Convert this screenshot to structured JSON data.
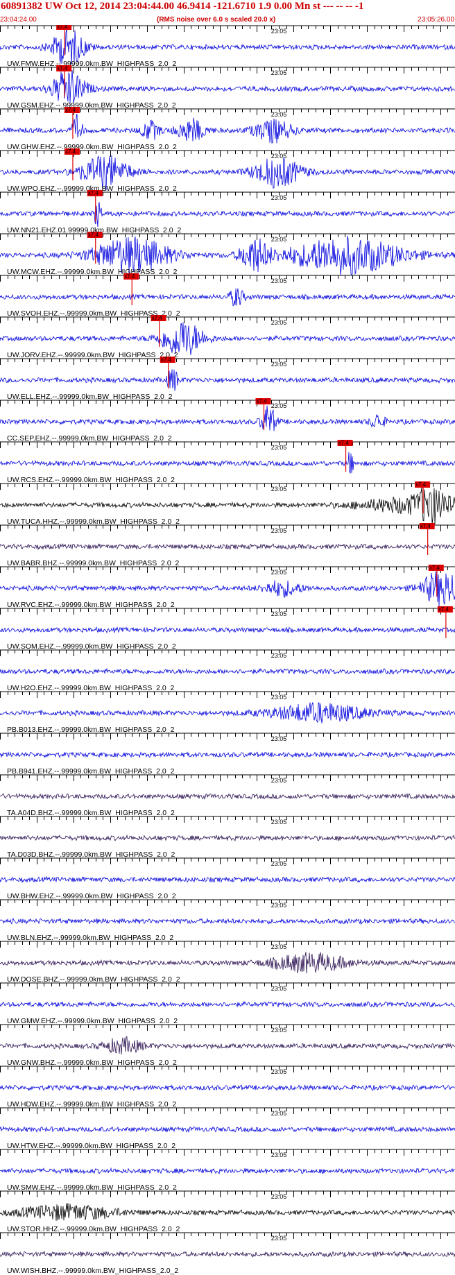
{
  "header": {
    "title": "60891382 UW Oct 12, 2014 23:04:44.00   46.9414 -121.6710  1.9 0.00 Mn st --- -- --   -1",
    "start_time": "23:04:24.00",
    "note": "(RMS noise over 6.0 s scaled 20.0 x)",
    "end_time": "23:05:26.00"
  },
  "minute_label": "23:05",
  "pick_label": "x7.4",
  "colors": {
    "header_text": "#cc0000",
    "trace_blue": "#0000dd",
    "trace_black": "#000000",
    "trace_purple": "#2a1050",
    "pick_marker": "#dd0000",
    "axis": "#000000"
  },
  "traces": [
    {
      "label": "UW.FMW.EHZ.--.99999.0km.BW_HIGHPASS_2.0_2",
      "color": "blue",
      "pick": 0.142,
      "bursts": [
        {
          "c": 0.15,
          "w": 0.035,
          "a": 1.0
        }
      ]
    },
    {
      "label": "UW.GSM.EHZ.--.99999.0km.BW_HIGHPASS_2.0_2",
      "color": "blue",
      "pick": 0.142,
      "bursts": [
        {
          "c": 0.15,
          "w": 0.035,
          "a": 1.0
        }
      ]
    },
    {
      "label": "UW.GHW.EHZ.--.99999.0km.BW_HIGHPASS_2.0_2",
      "color": "blue",
      "pick": 0.16,
      "bursts": [
        {
          "c": 0.17,
          "w": 0.01,
          "a": 0.8
        },
        {
          "c": 0.33,
          "w": 0.02,
          "a": 0.5
        },
        {
          "c": 0.42,
          "w": 0.03,
          "a": 0.6
        },
        {
          "c": 0.6,
          "w": 0.04,
          "a": 0.6
        }
      ]
    },
    {
      "label": "UW.WPO.EHZ.--.99999.0km.BW_HIGHPASS_2.0_2",
      "color": "blue",
      "pick": 0.16,
      "bursts": [
        {
          "c": 0.23,
          "w": 0.05,
          "a": 0.9
        },
        {
          "c": 0.61,
          "w": 0.05,
          "a": 0.8
        }
      ]
    },
    {
      "label": "UW.NN21.EHZ.01.99999.0km.BW_HIGHPASS_2.0_2",
      "color": "blue",
      "pick": 0.21,
      "bursts": [
        {
          "c": 0.215,
          "w": 0.008,
          "a": 0.7
        }
      ]
    },
    {
      "label": "UW.MCW.EHZ.--.99999.0km.BW_HIGHPASS_2.0_2",
      "color": "blue",
      "pick": 0.21,
      "bursts": [
        {
          "c": 0.29,
          "w": 0.08,
          "a": 1.0
        },
        {
          "c": 0.56,
          "w": 0.03,
          "a": 0.9
        },
        {
          "c": 0.76,
          "w": 0.12,
          "a": 1.0
        }
      ]
    },
    {
      "label": "UW.SVOH.EHZ.--.99999.0km.BW_HIGHPASS_2.0_2",
      "color": "blue",
      "pick": 0.29,
      "bursts": [
        {
          "c": 0.52,
          "w": 0.015,
          "a": 0.5
        }
      ]
    },
    {
      "label": "UW.JORV.EHZ.--.99999.0km.BW_HIGHPASS_2.0_2",
      "color": "blue",
      "pick": 0.35,
      "bursts": [
        {
          "c": 0.4,
          "w": 0.045,
          "a": 1.0
        }
      ]
    },
    {
      "label": "UW.ELL.EHZ.--.99999.0km.BW_HIGHPASS_2.0_2",
      "color": "blue",
      "pick": 0.37,
      "bursts": [
        {
          "c": 0.38,
          "w": 0.012,
          "a": 0.6
        }
      ]
    },
    {
      "label": "CC.SEP.EHZ.--.99999.0km.BW_HIGHPASS_2.0_2",
      "color": "blue",
      "pick": 0.58,
      "bursts": [
        {
          "c": 0.59,
          "w": 0.015,
          "a": 0.9
        },
        {
          "c": 0.83,
          "w": 0.015,
          "a": 0.4
        }
      ]
    },
    {
      "label": "UW.RCS.EHZ.--.99999.0km.BW_HIGHPASS_2.0_2",
      "color": "blue",
      "pick": 0.76,
      "bursts": [
        {
          "c": 0.77,
          "w": 0.006,
          "a": 0.7
        }
      ]
    },
    {
      "label": "UW.TUCA.HHZ.--.99999.0km.BW_HIGHPASS_2.0_2",
      "color": "black",
      "pick": 0.93,
      "bursts": [
        {
          "c": 0.92,
          "w": 0.12,
          "a": 0.45
        },
        {
          "c": 0.95,
          "w": 0.025,
          "a": 1.0
        }
      ]
    },
    {
      "label": "UW.BABR.BHZ.--.99999.0km.BW_HIGHPASS_2.0_2",
      "color": "purple",
      "pick": 0.94,
      "bursts": []
    },
    {
      "label": "UW.RVC.EHZ.--.99999.0km.BW_HIGHPASS_2.0_2",
      "color": "blue",
      "pick": 0.96,
      "bursts": [
        {
          "c": 0.62,
          "w": 0.04,
          "a": 0.4
        },
        {
          "c": 0.97,
          "w": 0.04,
          "a": 1.0
        }
      ]
    },
    {
      "label": "UW.SOM.EHZ.--.99999.0km.BW_HIGHPASS_2.0_2",
      "color": "blue",
      "pick": 0.98,
      "bursts": []
    },
    {
      "label": "UW.H2O.EHZ.--.99999.0km.BW_HIGHPASS_2.0_2",
      "color": "blue",
      "pick": null,
      "bursts": []
    },
    {
      "label": "PB.B013.EHZ.--.99999.0km.BW_HIGHPASS_2.0_2",
      "color": "blue",
      "pick": null,
      "bursts": [
        {
          "c": 0.7,
          "w": 0.1,
          "a": 0.5
        }
      ]
    },
    {
      "label": "PB.B941.EHZ.--.99999.0km.BW_HIGHPASS_2.0_2",
      "color": "blue",
      "pick": null,
      "bursts": []
    },
    {
      "label": "TA.A04D.BHZ.--.99999.0km.BW_HIGHPASS_2.0_2",
      "color": "purple",
      "pick": null,
      "bursts": []
    },
    {
      "label": "TA.D03D.BHZ.--.99999.0km.BW_HIGHPASS_2.0_2",
      "color": "purple",
      "pick": null,
      "bursts": []
    },
    {
      "label": "UW.BHW.EHZ.--.99999.0km.BW_HIGHPASS_2.0_2",
      "color": "blue",
      "pick": null,
      "bursts": []
    },
    {
      "label": "UW.BLN.EHZ.--.99999.0km.BW_HIGHPASS_2.0_2",
      "color": "blue",
      "pick": null,
      "bursts": []
    },
    {
      "label": "UW.DOSE.BHZ.--.99999.0km.BW_HIGHPASS_2.0_2",
      "color": "purple",
      "pick": null,
      "bursts": [
        {
          "c": 0.68,
          "w": 0.08,
          "a": 0.5
        }
      ]
    },
    {
      "label": "UW.GMW.EHZ.--.99999.0km.BW_HIGHPASS_2.0_2",
      "color": "blue",
      "pick": null,
      "bursts": []
    },
    {
      "label": "UW.GNW.BHZ.--.99999.0km.BW_HIGHPASS_2.0_2",
      "color": "purple",
      "pick": null,
      "bursts": [
        {
          "c": 0.27,
          "w": 0.04,
          "a": 0.4
        }
      ]
    },
    {
      "label": "UW.HDW.EHZ.--.99999.0km.BW_HIGHPASS_2.0_2",
      "color": "blue",
      "pick": null,
      "bursts": []
    },
    {
      "label": "UW.HTW.EHZ.--.99999.0km.BW_HIGHPASS_2.0_2",
      "color": "blue",
      "pick": null,
      "bursts": []
    },
    {
      "label": "UW.SMW.EHZ.--.99999.0km.BW_HIGHPASS_2.0_2",
      "color": "blue",
      "pick": null,
      "bursts": []
    },
    {
      "label": "UW.STOR.HHZ.--.99999.0km.BW_HIGHPASS_2.0_2",
      "color": "black",
      "pick": null,
      "bursts": [
        {
          "c": 0.15,
          "w": 0.1,
          "a": 0.4
        }
      ]
    },
    {
      "label": "UW.WISH.BHZ.--.99999.0km.BW_HIGHPASS_2.0_2",
      "color": "purple",
      "pick": null,
      "bursts": []
    }
  ]
}
